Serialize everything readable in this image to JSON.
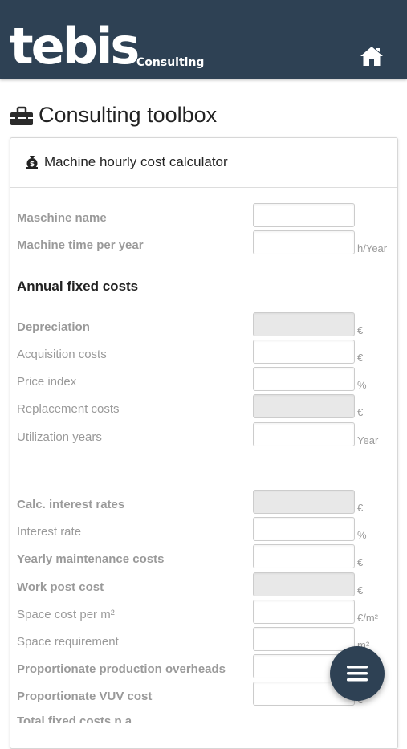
{
  "header": {
    "logo_text": "tebis",
    "logo_sub": "Consulting",
    "home_icon": "home-icon",
    "bg_color": "#2e4154"
  },
  "page": {
    "title": "Consulting toolbox",
    "title_icon": "toolbox-icon"
  },
  "card": {
    "title": "Machine hourly cost calculator",
    "title_icon": "money-bag-icon"
  },
  "fields": {
    "machine_name": {
      "label": "Maschine name",
      "unit": ""
    },
    "machine_time": {
      "label": "Machine time per year",
      "unit": "h/Year"
    }
  },
  "section": {
    "annual_fixed_costs": "Annual fixed costs"
  },
  "rows": {
    "depreciation": {
      "label": "Depreciation",
      "unit": "€"
    },
    "acquisition": {
      "label": "Acquisition costs",
      "unit": "€"
    },
    "price_index": {
      "label": "Price index",
      "unit": "%"
    },
    "replacement": {
      "label": "Replacement costs",
      "unit": "€"
    },
    "utilization": {
      "label": "Utilization years",
      "unit": "Year"
    },
    "calc_interest": {
      "label": "Calc. interest rates",
      "unit": "€"
    },
    "interest_rate": {
      "label": "Interest rate",
      "unit": "%"
    },
    "maintenance": {
      "label": "Yearly maintenance costs",
      "unit": "€"
    },
    "work_post": {
      "label": "Work post cost",
      "unit": "€"
    },
    "space_cost": {
      "label": "Space cost per m²",
      "unit": "€/m²"
    },
    "space_req": {
      "label": "Space requirement",
      "unit": "m²"
    },
    "prod_overheads": {
      "label": "Proportionate production overheads",
      "unit": "€"
    },
    "vuv_cost": {
      "label": "Proportionate VUV cost",
      "unit": "€"
    },
    "total_fixed": {
      "label": "Total fixed costs p.a.",
      "unit": "€"
    }
  },
  "fab": {
    "icon": "menu-icon"
  }
}
